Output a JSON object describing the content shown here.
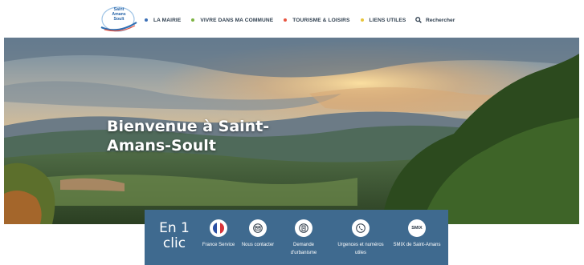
{
  "header": {
    "logo_text": "Saint Amans Soult",
    "nav": [
      {
        "label": "LA MAIRIE",
        "dot_color": "#3b6fb6"
      },
      {
        "label": "VIVRE DANS MA COMMUNE",
        "dot_color": "#7cb342"
      },
      {
        "label": "TOURISME & LOISIRS",
        "dot_color": "#e8533f"
      },
      {
        "label": "LIENS UTILES",
        "dot_color": "#e8c53a"
      }
    ],
    "search_label": "Rechercher"
  },
  "hero": {
    "title": "Bienvenue à Saint-Amans-Soult"
  },
  "quick_access": {
    "title": "En 1 clic",
    "items": [
      {
        "label": "France Service",
        "icon": "france-flag-icon"
      },
      {
        "label": "Nous contacter",
        "icon": "envelope-icon"
      },
      {
        "label": "Demande d'urbanisme",
        "icon": "document-icon"
      },
      {
        "label": "Urgences et numéros utiles",
        "icon": "phone-icon"
      },
      {
        "label": "SMIX de Saint-Amans",
        "icon": "smix-icon",
        "icon_text": "SMIX"
      }
    ]
  }
}
